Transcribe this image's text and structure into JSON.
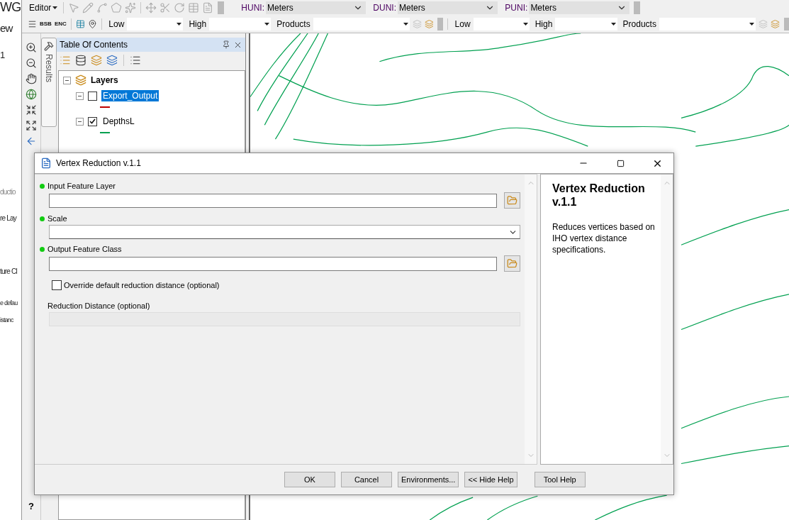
{
  "background_window": {
    "texts": [
      "WG",
      "ew",
      "1",
      "ductio",
      "re Lay",
      "ture Cl",
      "e defau",
      "istanc"
    ]
  },
  "editor_toolbar": {
    "menu": "Editor",
    "unit_selects": [
      {
        "label": "HUNI:",
        "value": "Meters"
      },
      {
        "label": "DUNI:",
        "value": "Meters"
      },
      {
        "label": "PUNI:",
        "value": "Meters"
      }
    ]
  },
  "chart_toolbar": {
    "icon_texts": [
      "BSB",
      "ENC"
    ],
    "filter_sets": [
      {
        "filters": [
          "Low",
          "High",
          "Products"
        ]
      },
      {
        "filters": [
          "Low",
          "High",
          "Products"
        ]
      }
    ]
  },
  "side_tab": "Results",
  "help_glyph": "?",
  "toc": {
    "title": "Table Of Contents",
    "root": {
      "label": "Layers",
      "expanded": true,
      "children": [
        {
          "label": "Export_Output",
          "expanded": true,
          "checked": false,
          "selected": true,
          "color": "#c00000"
        },
        {
          "label": "DepthsL",
          "expanded": true,
          "checked": true,
          "selected": false,
          "color": "#00a050"
        }
      ]
    }
  },
  "dialog": {
    "title": "Vertex Reduction v.1.1",
    "params": [
      {
        "kind": "text",
        "label": "Input Feature Layer",
        "required": true,
        "browse": true
      },
      {
        "kind": "select",
        "label": "Scale",
        "required": true
      },
      {
        "kind": "text",
        "label": "Output Feature Class",
        "required": true,
        "browse": true
      },
      {
        "kind": "checkbox",
        "label": "Override default reduction distance (optional)",
        "checked": false
      },
      {
        "kind": "text",
        "label": "Reduction Distance (optional)",
        "required": false,
        "disabled": true
      }
    ],
    "help": {
      "title": "Vertex Reduction v.1.1",
      "text": "Reduces vertices based on IHO vertex distance specifications."
    },
    "buttons": [
      "OK",
      "Cancel",
      "Environments...",
      "<< Hide Help",
      "Tool Help"
    ]
  }
}
